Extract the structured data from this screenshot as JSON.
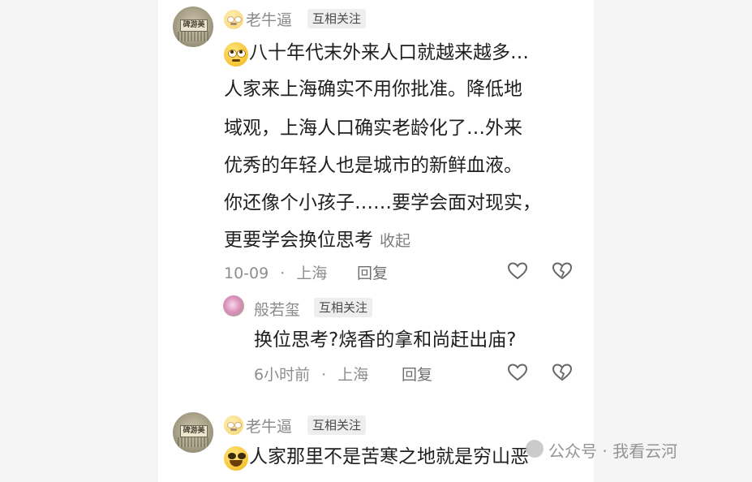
{
  "comments": [
    {
      "author": "老牛逼",
      "badge": "互相关注",
      "avatar_text": "碑游美",
      "lines": [
        "八十年代末外来人口就越来越多…",
        "人家来上海确实不用你批准。降低地",
        "域观，上海人口确实老龄化了…外来",
        "优秀的年轻人也是城市的新鲜血液。",
        "你还像个小孩子……要学会面对现实，",
        "更要学会换位思考"
      ],
      "collapse_label": "收起",
      "date": "10-09",
      "dot": "·",
      "location": "上海",
      "reply_label": "回复",
      "replies": [
        {
          "author": "般若玺",
          "badge": "互相关注",
          "text": "换位思考?烧香的拿和尚赶出庙?",
          "time": "6小时前",
          "dot": "·",
          "location": "上海",
          "reply_label": "回复"
        }
      ]
    },
    {
      "author": "老牛逼",
      "badge": "互相关注",
      "avatar_text": "碑游美",
      "lines": [
        "人家那里不是苦寒之地就是穷山恶"
      ]
    }
  ],
  "watermark": {
    "text": "公众号 · 我看云河"
  },
  "icons": [
    "like-heart-icon",
    "dislike-broken-heart-icon"
  ]
}
